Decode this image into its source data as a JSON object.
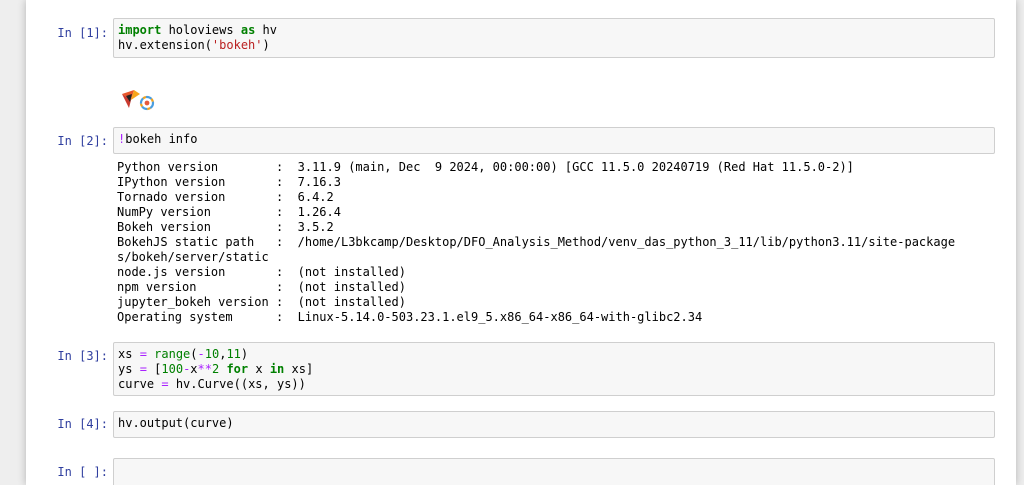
{
  "cells": [
    {
      "prompt": "In [1]:",
      "lines": [
        [
          {
            "t": "import",
            "c": "kw"
          },
          {
            "t": " holoviews ",
            "c": ""
          },
          {
            "t": "as",
            "c": "kw"
          },
          {
            "t": " hv",
            "c": ""
          }
        ],
        [
          {
            "t": "hv.extension(",
            "c": ""
          },
          {
            "t": "'bokeh'",
            "c": "str"
          },
          {
            "t": ")",
            "c": ""
          }
        ]
      ]
    },
    {
      "prompt": "In [2]:",
      "lines": [
        [
          {
            "t": "!",
            "c": "magic"
          },
          {
            "t": "bokeh info",
            "c": ""
          }
        ]
      ],
      "output": [
        "Python version        :  3.11.9 (main, Dec  9 2024, 00:00:00) [GCC 11.5.0 20240719 (Red Hat 11.5.0-2)]",
        "IPython version       :  7.16.3",
        "Tornado version       :  6.4.2",
        "NumPy version         :  1.26.4",
        "Bokeh version         :  3.5.2",
        "BokehJS static path   :  /home/L3bkcamp/Desktop/DFO_Analysis_Method/venv_das_python_3_11/lib/python3.11/site-package",
        "s/bokeh/server/static",
        "node.js version       :  (not installed)",
        "npm version           :  (not installed)",
        "jupyter_bokeh version :  (not installed)",
        "Operating system      :  Linux-5.14.0-503.23.1.el9_5.x86_64-x86_64-with-glibc2.34"
      ]
    },
    {
      "prompt": "In [3]:",
      "lines": [
        [
          {
            "t": "xs ",
            "c": ""
          },
          {
            "t": "=",
            "c": "op"
          },
          {
            "t": " ",
            "c": ""
          },
          {
            "t": "range",
            "c": "bi"
          },
          {
            "t": "(",
            "c": ""
          },
          {
            "t": "-",
            "c": "op"
          },
          {
            "t": "10",
            "c": "num"
          },
          {
            "t": ",",
            "c": ""
          },
          {
            "t": "11",
            "c": "num"
          },
          {
            "t": ")",
            "c": ""
          }
        ],
        [
          {
            "t": "ys ",
            "c": ""
          },
          {
            "t": "=",
            "c": "op"
          },
          {
            "t": " [",
            "c": ""
          },
          {
            "t": "100",
            "c": "num"
          },
          {
            "t": "-",
            "c": "op"
          },
          {
            "t": "x",
            "c": ""
          },
          {
            "t": "**",
            "c": "op"
          },
          {
            "t": "2",
            "c": "num"
          },
          {
            "t": " ",
            "c": ""
          },
          {
            "t": "for",
            "c": "kw"
          },
          {
            "t": " x ",
            "c": ""
          },
          {
            "t": "in",
            "c": "kw"
          },
          {
            "t": " xs]",
            "c": ""
          }
        ],
        [
          {
            "t": "curve ",
            "c": ""
          },
          {
            "t": "=",
            "c": "op"
          },
          {
            "t": " hv.Curve((xs, ys))",
            "c": ""
          }
        ]
      ]
    },
    {
      "prompt": "In [4]:",
      "lines": [
        [
          {
            "t": "hv.output(curve)",
            "c": ""
          }
        ]
      ]
    },
    {
      "prompt": "In [ ]:",
      "lines": [
        [
          {
            "t": "",
            "c": ""
          }
        ]
      ]
    }
  ]
}
